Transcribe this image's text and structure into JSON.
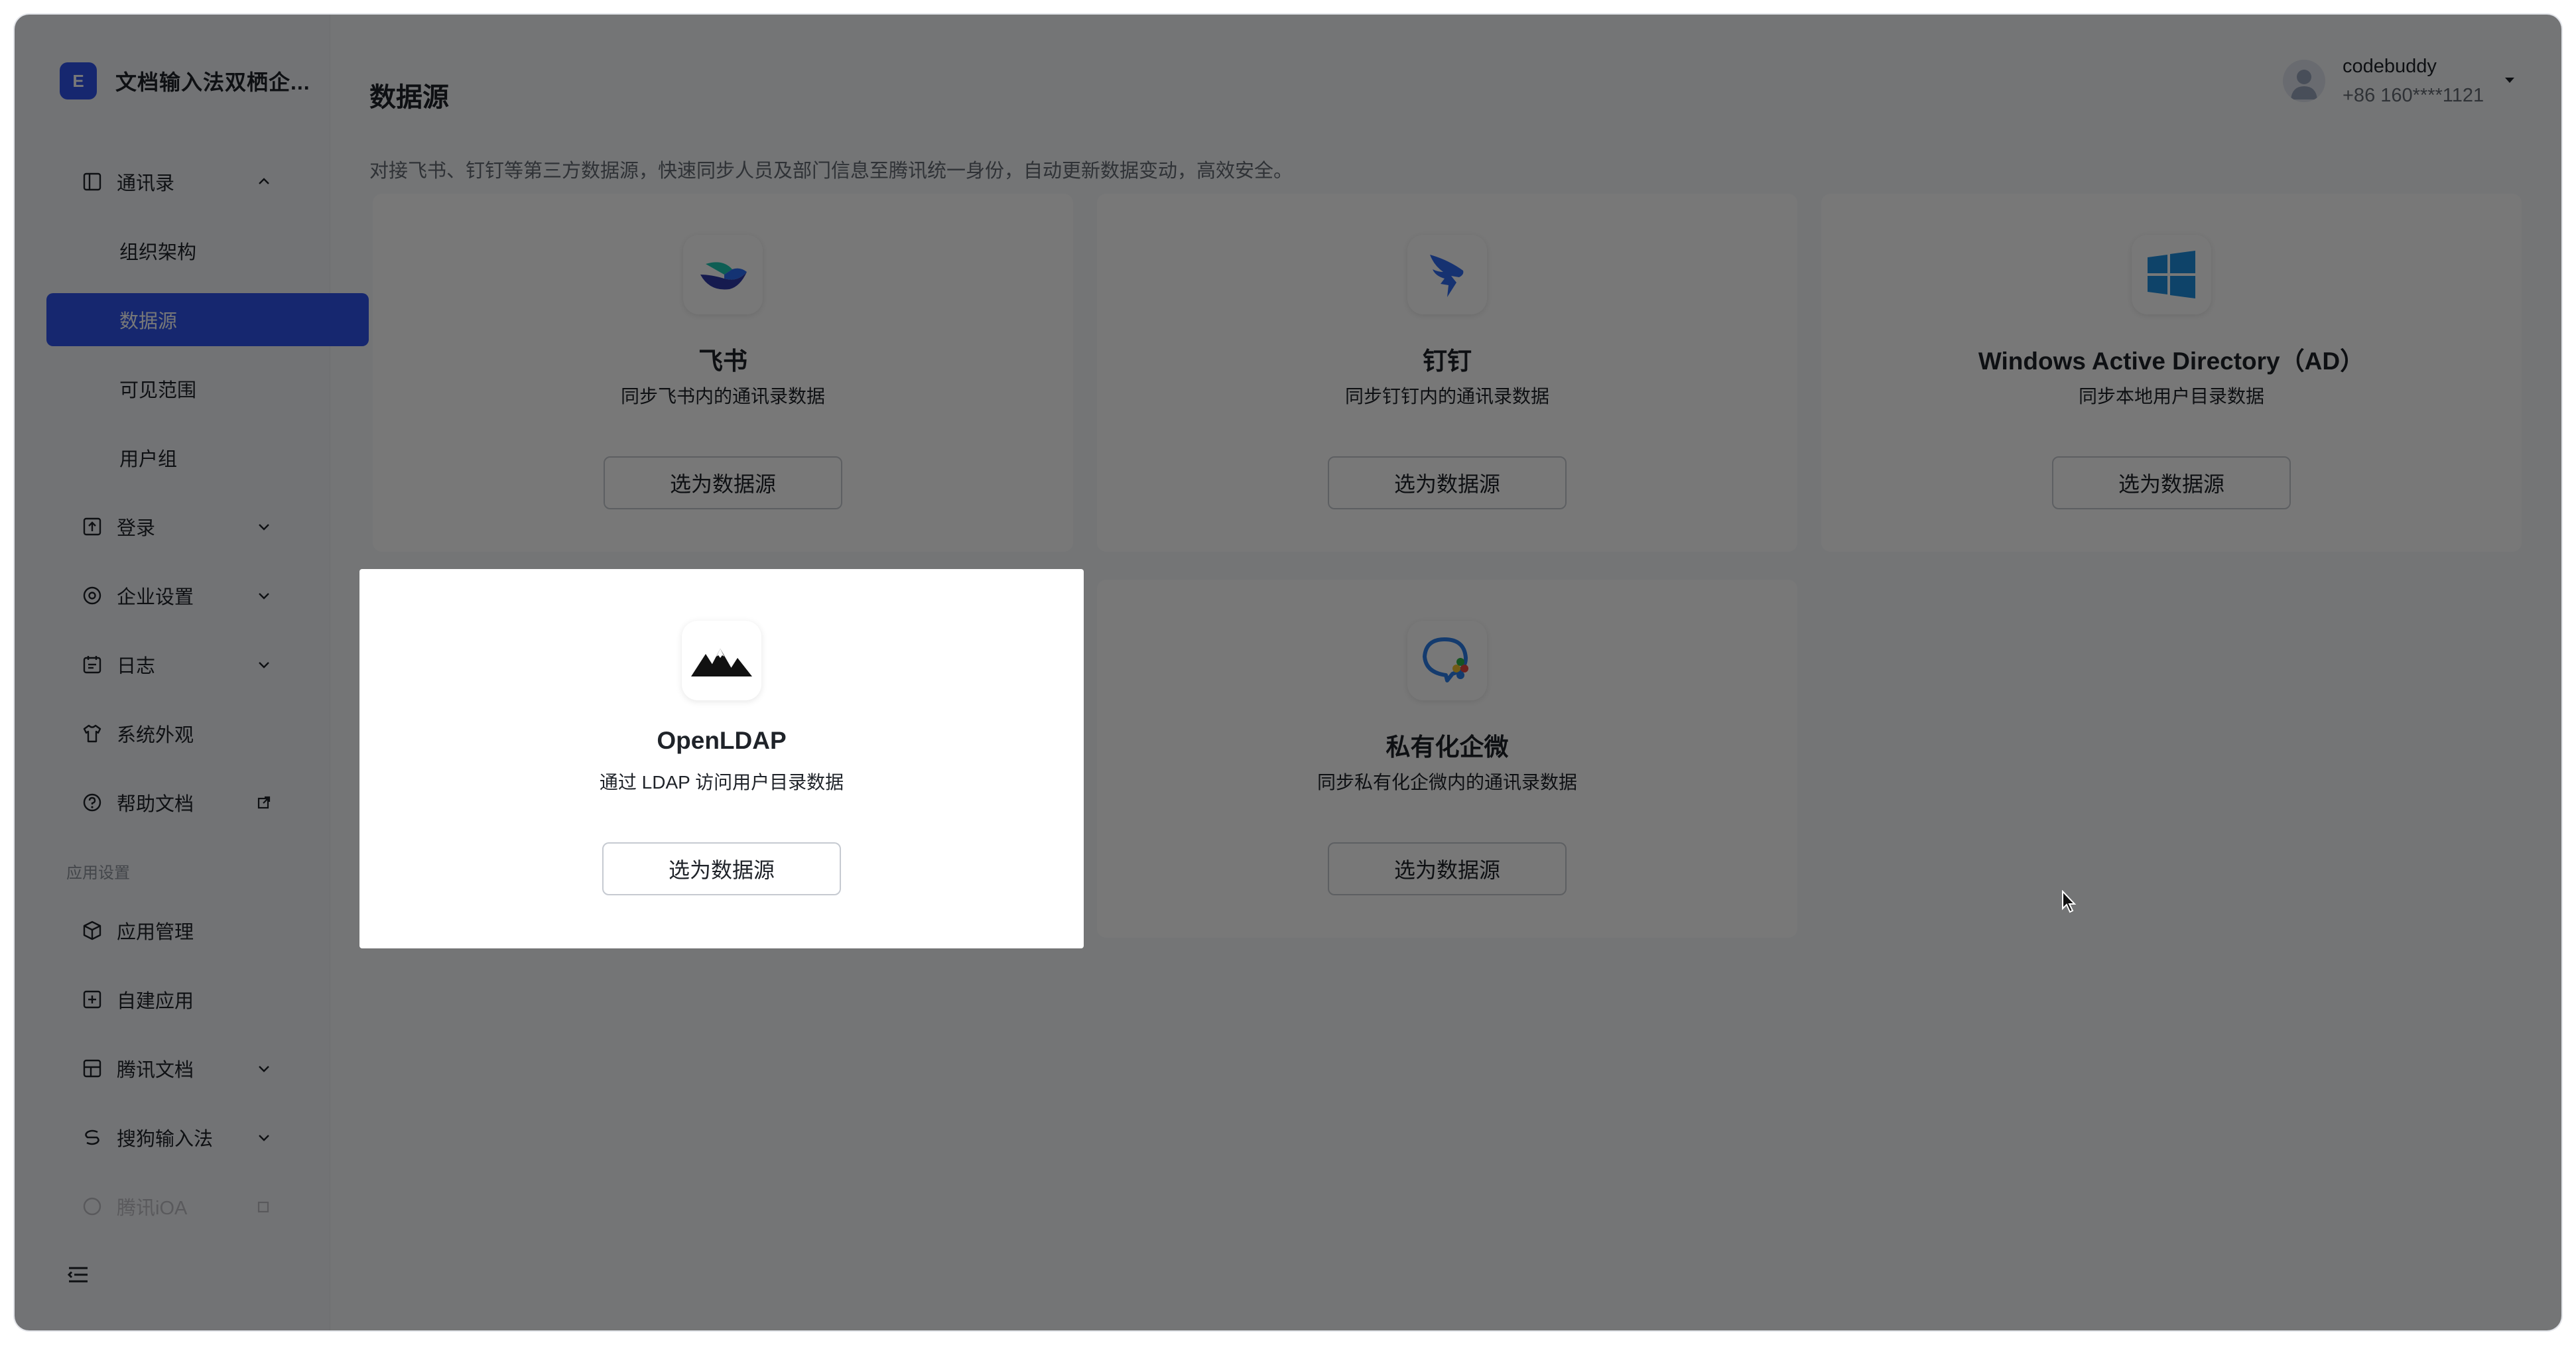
{
  "brand": {
    "name": "文档输入法双栖企...",
    "logo_text": "E"
  },
  "sidebar": {
    "groups": [
      {
        "label": "通讯录",
        "icon": "contacts-icon",
        "expanded": true,
        "children": [
          {
            "label": "组织架构"
          },
          {
            "label": "数据源",
            "active": true
          },
          {
            "label": "可见范围"
          },
          {
            "label": "用户组"
          }
        ]
      }
    ],
    "items": [
      {
        "label": "登录",
        "icon": "login-icon"
      },
      {
        "label": "企业设置",
        "icon": "settings-icon"
      },
      {
        "label": "日志",
        "icon": "log-icon"
      },
      {
        "label": "系统外观",
        "icon": "appearance-icon"
      },
      {
        "label": "帮助文档",
        "icon": "help-icon"
      }
    ],
    "section_title": "应用设置",
    "app_items": [
      {
        "label": "应用管理",
        "icon": "app-manage-icon"
      },
      {
        "label": "自建应用",
        "icon": "custom-app-icon"
      },
      {
        "label": "腾讯文档",
        "icon": "tencent-docs-icon"
      },
      {
        "label": "搜狗输入法",
        "icon": "sogou-icon"
      },
      {
        "label": "腾讯iOA",
        "icon": "ioa-icon"
      }
    ]
  },
  "header": {
    "title": "数据源",
    "description": "对接飞书、钉钉等第三方数据源，快速同步人员及部门信息至腾讯统一身份，自动更新数据变动，高效安全。"
  },
  "user": {
    "name": "codebuddy",
    "phone": "+86 160****1121"
  },
  "sources": [
    {
      "title": "飞书",
      "desc": "同步飞书内的通讯录数据",
      "button": "选为数据源",
      "icon": "feishu-icon"
    },
    {
      "title": "钉钉",
      "desc": "同步钉钉内的通讯录数据",
      "button": "选为数据源",
      "icon": "dingtalk-icon"
    },
    {
      "title": "Windows Active Directory（AD）",
      "desc": "同步本地用户目录数据",
      "button": "选为数据源",
      "icon": "windows-icon"
    },
    {
      "title": "OpenLDAP",
      "desc": "通过 LDAP 访问用户目录数据",
      "button": "选为数据源",
      "icon": "openldap-icon",
      "highlighted": true
    },
    {
      "title": "私有化企微",
      "desc": "同步私有化企微内的通讯录数据",
      "button": "选为数据源",
      "icon": "wecom-icon"
    }
  ],
  "colors": {
    "accent": "#2f54eb",
    "overlay": "rgba(0,0,0,0.53)"
  }
}
